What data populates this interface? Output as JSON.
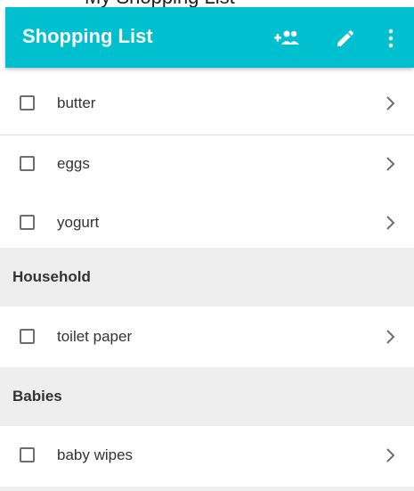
{
  "app": {
    "status_text": "My Shopping List",
    "title": "Shopping List",
    "accent_color": "#00c0d0"
  },
  "toolbar": {
    "share_icon": "add-people-icon",
    "edit_icon": "pencil-icon",
    "more_icon": "more-vert-icon"
  },
  "items": [
    {
      "label": "butter",
      "checked": false
    },
    {
      "label": "eggs",
      "checked": false
    },
    {
      "label": "yogurt",
      "checked": false
    },
    {
      "label": "toilet paper",
      "checked": false
    },
    {
      "label": "baby wipes",
      "checked": false
    }
  ],
  "sections": [
    {
      "label": "Household"
    },
    {
      "label": "Babies"
    }
  ]
}
